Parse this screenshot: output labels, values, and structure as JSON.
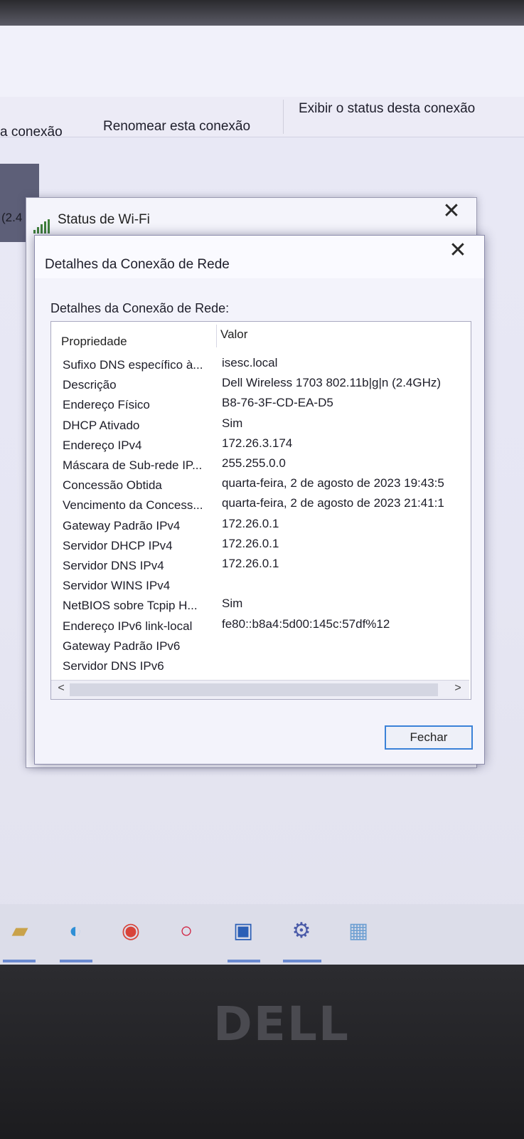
{
  "background_window": {
    "commands": [
      "a conexão",
      "Renomear esta conexão",
      "Exibir o status desta conexão"
    ],
    "side_text": "(2.4"
  },
  "status_dialog": {
    "title": "Status de Wi-Fi",
    "close_glyph": "✕"
  },
  "details_dialog": {
    "title": "Detalhes da Conexão de Rede",
    "close_glyph": "✕",
    "section_label": "Detalhes da Conexão de Rede:",
    "columns": {
      "property": "Propriedade",
      "value": "Valor"
    },
    "rows": [
      {
        "property": "Sufixo DNS específico à...",
        "value": "isesc.local"
      },
      {
        "property": "Descrição",
        "value": "Dell Wireless 1703 802.11b|g|n (2.4GHz)"
      },
      {
        "property": "Endereço Físico",
        "value": "B8-76-3F-CD-EA-D5"
      },
      {
        "property": "DHCP Ativado",
        "value": "Sim"
      },
      {
        "property": "Endereço IPv4",
        "value": "172.26.3.174"
      },
      {
        "property": "Máscara de Sub-rede IP...",
        "value": "255.255.0.0"
      },
      {
        "property": "Concessão Obtida",
        "value": "quarta-feira, 2 de agosto de 2023 19:43:5"
      },
      {
        "property": "Vencimento da Concess...",
        "value": "quarta-feira, 2 de agosto de 2023 21:41:1"
      },
      {
        "property": "Gateway Padrão IPv4",
        "value": "172.26.0.1"
      },
      {
        "property": "Servidor DHCP IPv4",
        "value": "172.26.0.1"
      },
      {
        "property": "Servidor DNS IPv4",
        "value": "172.26.0.1"
      },
      {
        "property": "Servidor WINS IPv4",
        "value": ""
      },
      {
        "property": "NetBIOS sobre Tcpip H...",
        "value": "Sim"
      },
      {
        "property": "Endereço IPv6 link-local",
        "value": "fe80::b8a4:5d00:145c:57df%12"
      },
      {
        "property": "Gateway Padrão IPv6",
        "value": ""
      },
      {
        "property": "Servidor DNS IPv6",
        "value": ""
      }
    ],
    "scroll_left_glyph": "<",
    "scroll_right_glyph": ">",
    "close_button_label": "Fechar"
  },
  "taskbar": {
    "icons": [
      "file-explorer-icon",
      "edge-icon",
      "chrome-icon",
      "opera-icon",
      "word-icon",
      "settings-icon",
      "remote-desktop-icon"
    ]
  },
  "bezel": {
    "brand": "DELL"
  }
}
